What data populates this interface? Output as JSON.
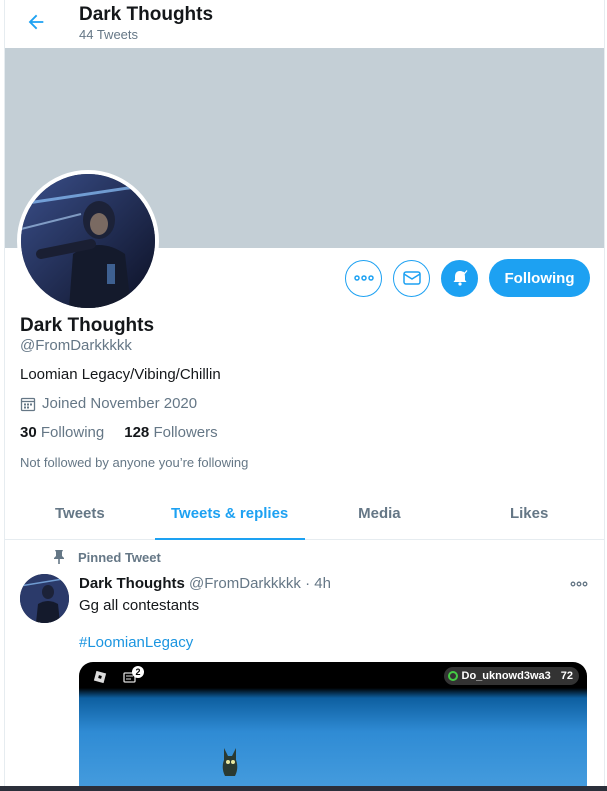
{
  "header": {
    "title": "Dark Thoughts",
    "subtitle": "44 Tweets"
  },
  "profile": {
    "name": "Dark Thoughts",
    "handle": "@FromDarkkkkk",
    "bio": "Loomian Legacy/Vibing/Chillin",
    "joined": "Joined November 2020",
    "following_count": "30",
    "following_label": "Following",
    "followers_count": "128",
    "followers_label": "Followers",
    "not_followed": "Not followed by anyone you’re following",
    "follow_button": "Following"
  },
  "tabs": [
    {
      "label": "Tweets"
    },
    {
      "label": "Tweets & replies"
    },
    {
      "label": "Media"
    },
    {
      "label": "Likes"
    }
  ],
  "tweet": {
    "pinned_label": "Pinned Tweet",
    "author": "Dark Thoughts",
    "meta": "@FromDarkkkkk · 4h",
    "text": "Gg all contestants",
    "hashtag": "#LoomianLegacy",
    "media": {
      "player_name": "Do_uknowd3wa3",
      "player_level": "72",
      "badge_count": "2"
    }
  },
  "colors": {
    "accent": "#1da1f2",
    "banner": "#c4cfd6",
    "muted": "#657786"
  }
}
